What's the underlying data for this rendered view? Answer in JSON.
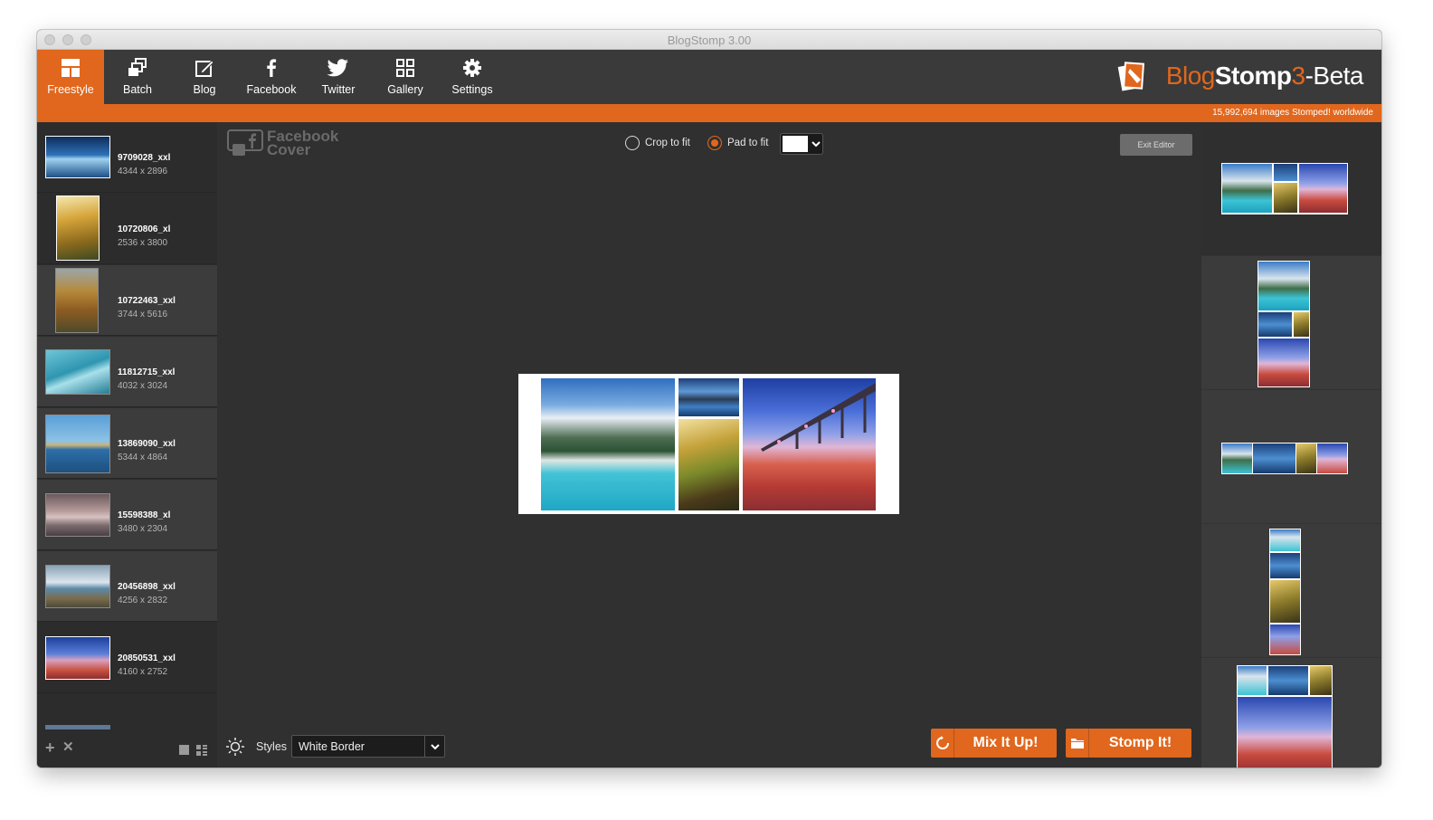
{
  "window": {
    "title": "BlogStomp 3.00"
  },
  "toolbar": {
    "tabs": [
      {
        "label": "Freestyle",
        "icon": "freestyle-icon",
        "active": true
      },
      {
        "label": "Batch",
        "icon": "batch-icon"
      },
      {
        "label": "Blog",
        "icon": "blog-icon"
      },
      {
        "label": "Facebook",
        "icon": "facebook-icon"
      },
      {
        "label": "Twitter",
        "icon": "twitter-icon"
      },
      {
        "label": "Gallery",
        "icon": "gallery-icon"
      },
      {
        "label": "Settings",
        "icon": "gear-icon"
      }
    ],
    "logo": {
      "part1": "Blog",
      "part2": "Stomp",
      "part3": "3",
      "part4": "-Beta"
    }
  },
  "status": {
    "text": "15,992,694 images Stomped! worldwide"
  },
  "sidebar": {
    "images": [
      {
        "name": "9709028_xxl",
        "dims": "4344 x 2896"
      },
      {
        "name": "10720806_xl",
        "dims": "2536 x 3800"
      },
      {
        "name": "10722463_xxl",
        "dims": "3744 x 5616"
      },
      {
        "name": "11812715_xxl",
        "dims": "4032 x 3024"
      },
      {
        "name": "13869090_xxl",
        "dims": "5344 x 4864"
      },
      {
        "name": "15598388_xl",
        "dims": "3480 x 2304"
      },
      {
        "name": "20456898_xxl",
        "dims": "4256 x 2832"
      },
      {
        "name": "20850531_xxl",
        "dims": "4160 x 2752"
      }
    ],
    "footer": {
      "add": "+",
      "remove": "✕"
    }
  },
  "editor": {
    "format_label_1": "Facebook",
    "format_label_2": "Cover",
    "crop_label": "Crop to fit",
    "pad_label": "Pad to fit",
    "pad_selected": true,
    "pad_color": "#ffffff",
    "exit_label": "Exit Editor",
    "styles_label": "Styles",
    "styles_value": "White Border",
    "mix_label": "Mix It Up!",
    "stomp_label": "Stomp It!"
  },
  "colors": {
    "accent": "#e0671d",
    "toolbar": "#3a3a3a",
    "background": "#303030"
  }
}
